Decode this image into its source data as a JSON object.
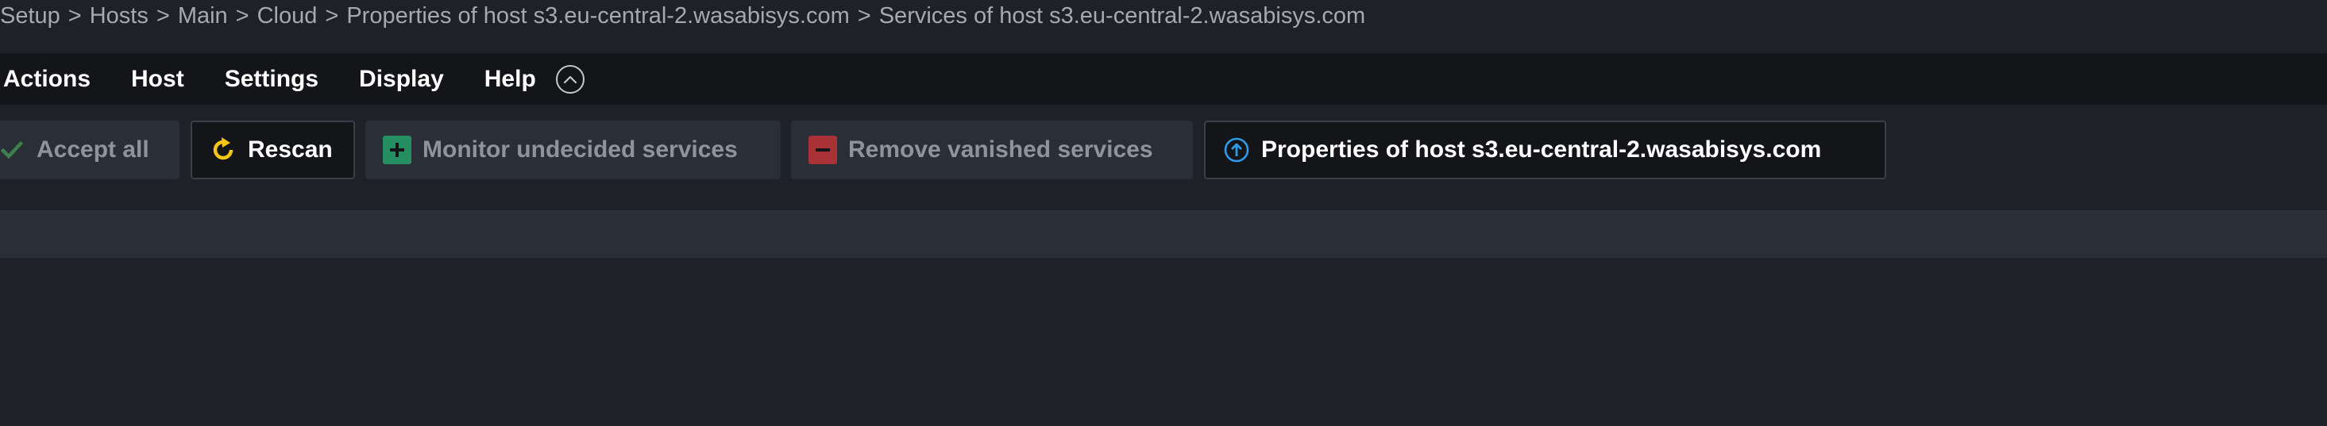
{
  "breadcrumb": {
    "separator": ">",
    "items": [
      "Setup",
      "Hosts",
      "Main",
      "Cloud",
      "Properties of host s3.eu-central-2.wasabisys.com",
      "Services of host s3.eu-central-2.wasabisys.com"
    ]
  },
  "menu": {
    "actions": "Actions",
    "host": "Host",
    "settings": "Settings",
    "display": "Display",
    "help": "Help"
  },
  "toolbar": {
    "accept_all": "Accept all",
    "rescan": "Rescan",
    "monitor_undecided": "Monitor undecided services",
    "remove_vanished": "Remove vanished services",
    "host_properties": "Properties of host s3.eu-central-2.wasabisys.com"
  },
  "colors": {
    "background": "#1e2128",
    "menubar": "#131519",
    "button_disabled_bg": "#2a2f37",
    "accept_green": "#3f7f4e",
    "rescan_yellow": "#f5c518",
    "monitor_green": "#268f62",
    "remove_red": "#a83236",
    "properties_blue": "#2f9ae6"
  },
  "icons": {
    "accept": "checkmark-icon",
    "rescan": "refresh-icon",
    "monitor": "plus-square-icon",
    "remove": "minus-square-icon",
    "properties": "circle-arrow-up-icon",
    "collapse": "chevron-up-circle-icon"
  }
}
